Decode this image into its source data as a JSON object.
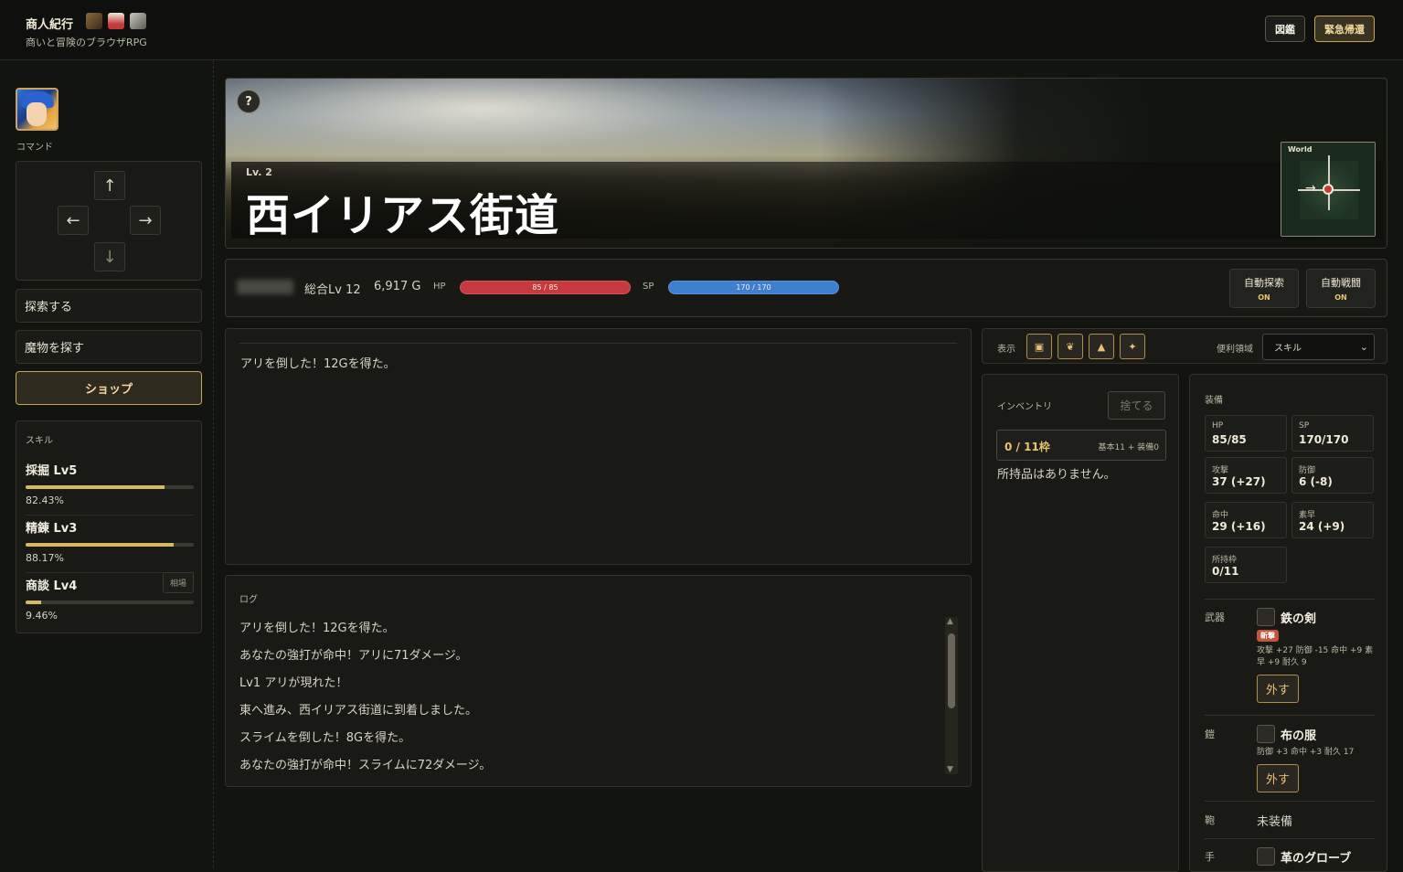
{
  "header": {
    "title": "商人紀行",
    "subtitle": "商いと冒険のブラウザRPG",
    "zukan_label": "図鑑",
    "emergency_label": "緊急帰還"
  },
  "sidebar": {
    "command_label": "コマンド",
    "dpad": {
      "up": "↑",
      "left": "←",
      "right": "→",
      "down": "↓"
    },
    "explore_label": "探索する",
    "monster_label": "魔物を探す",
    "shop_label": "ショップ",
    "skills_title": "スキル",
    "skills": [
      {
        "name": "採掘 Lv5",
        "percent": "82.43%",
        "progress": 0.8243
      },
      {
        "name": "精錬 Lv3",
        "percent": "88.17%",
        "progress": 0.8817
      },
      {
        "name": "商談 Lv4",
        "percent": "9.46%",
        "progress": 0.0946
      }
    ],
    "skill_edit_label": "相場"
  },
  "location": {
    "help_label": "?",
    "level": "Lv. 2",
    "name": "西イリアス街道",
    "minimap_label": "World"
  },
  "status": {
    "total_level": "総合Lv 12",
    "gold": "6,917 G",
    "hp_label": "HP",
    "hp_value": "85 / 85",
    "sp_label": "SP",
    "sp_value": "170 / 170",
    "auto_explore_label": "自動探索",
    "auto_explore_state": "ON",
    "auto_battle_label": "自動戦闘",
    "auto_battle_state": "ON"
  },
  "message": {
    "text": "アリを倒した！12Gを得た。"
  },
  "log": {
    "title": "ログ",
    "entries": [
      "アリを倒した！12Gを得た。",
      "あなたの強打が命中！アリに71ダメージ。",
      "Lv1 アリが現れた！",
      "東へ進み、西イリアス街道に到着しました。",
      "スライムを倒した！8Gを得た。",
      "あなたの強打が命中！スライムに72ダメージ。"
    ]
  },
  "view": {
    "label": "表示",
    "quick_label": "便利領域",
    "quick_value": "スキル"
  },
  "inventory": {
    "title": "インベントリ",
    "discard_label": "捨てる",
    "slots_value": "0 / 11枠",
    "slots_detail": "基本11 + 装備0",
    "empty_text": "所持品はありません。"
  },
  "equipment": {
    "title": "装備",
    "stats": [
      {
        "label": "HP",
        "value": "85/85"
      },
      {
        "label": "SP",
        "value": "170/170"
      },
      {
        "label": "攻撃",
        "value": "37 (+27)"
      },
      {
        "label": "防御",
        "value": "6 (-8)"
      },
      {
        "label": "命中",
        "value": "29 (+16)"
      },
      {
        "label": "素早",
        "value": "24 (+9)"
      },
      {
        "label": "所持枠",
        "value": "0/11"
      }
    ],
    "weapon_slot": "武器",
    "weapon_name": "鉄の剣",
    "weapon_badge": "新撃",
    "weapon_stats": "攻撃 +27 防御 -15 命中 +9 素早 +9 耐久 9",
    "armor_slot": "鎧",
    "armor_name": "布の服",
    "armor_stats": "防御 +3 命中 +3 耐久 17",
    "unequip_label": "外す",
    "head_slot": "鞄",
    "head_value": "未装備",
    "hand_slot": "手",
    "hand_name": "革のグローブ"
  },
  "colors": {
    "accent": "#c9a45a",
    "hp": "#c8393f",
    "sp": "#3f7fd0",
    "gold_text": "#e7c46f"
  }
}
